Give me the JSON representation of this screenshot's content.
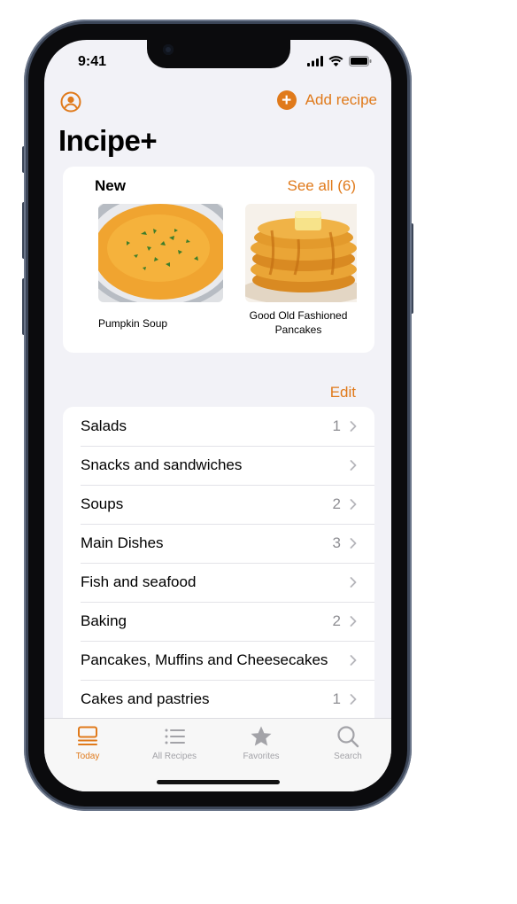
{
  "status_bar": {
    "time": "9:41"
  },
  "header": {
    "add_label": "Add recipe",
    "app_title": "Incipe+"
  },
  "new_section": {
    "title": "New",
    "see_all": "See all (6)",
    "recipes": [
      {
        "name": "Pumpkin Soup"
      },
      {
        "name": "Good Old Fashioned Pancakes"
      }
    ]
  },
  "categories_section": {
    "edit_label": "Edit",
    "items": [
      {
        "label": "Salads",
        "count": "1"
      },
      {
        "label": "Snacks and sandwiches",
        "count": ""
      },
      {
        "label": "Soups",
        "count": "2"
      },
      {
        "label": "Main Dishes",
        "count": "3"
      },
      {
        "label": "Fish and seafood",
        "count": ""
      },
      {
        "label": "Baking",
        "count": "2"
      },
      {
        "label": "Pancakes, Muffins and Cheesecakes",
        "count": ""
      },
      {
        "label": "Cakes and pastries",
        "count": "1"
      }
    ]
  },
  "tab_bar": {
    "tabs": [
      {
        "label": "Today",
        "icon": "today-icon",
        "active": true
      },
      {
        "label": "All Recipes",
        "icon": "list-icon",
        "active": false
      },
      {
        "label": "Favorites",
        "icon": "star-icon",
        "active": false
      },
      {
        "label": "Search",
        "icon": "search-icon",
        "active": false
      }
    ]
  },
  "colors": {
    "accent": "#e07a1b",
    "background": "#f2f2f7",
    "secondary_text": "#8e8e93",
    "frame": "#3c4658"
  }
}
